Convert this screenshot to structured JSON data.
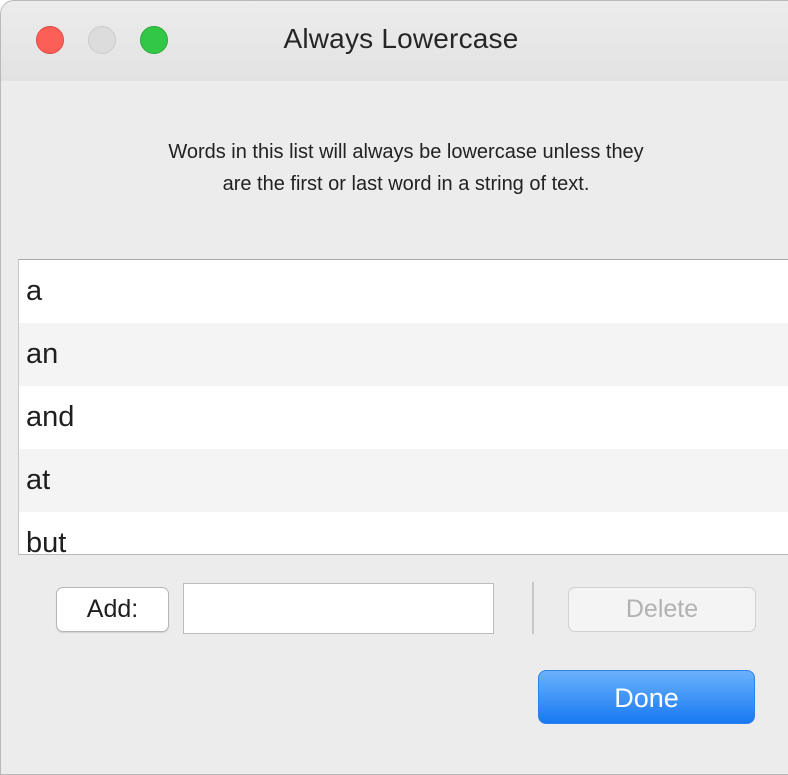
{
  "window": {
    "title": "Always Lowercase"
  },
  "description": {
    "line1": "Words in this list will always be lowercase unless they",
    "line2": "are the first or last word in a string of text."
  },
  "word_list": {
    "items": [
      "a",
      "an",
      "and",
      "at",
      "but"
    ]
  },
  "controls": {
    "add_label": "Add:",
    "add_value": "",
    "delete_label": "Delete",
    "done_label": "Done"
  },
  "colors": {
    "close": "#fc5f57",
    "minimize_disabled": "#dcdcdc",
    "zoom": "#33c748",
    "done_button": "#1f7ff3"
  }
}
